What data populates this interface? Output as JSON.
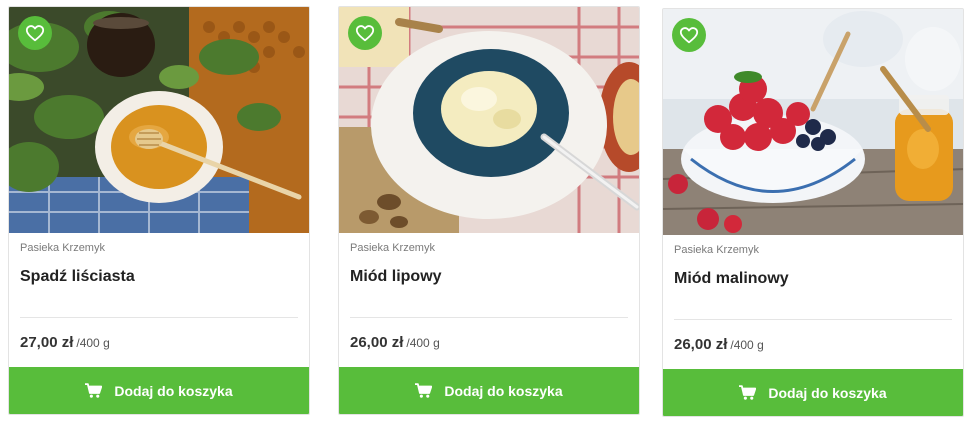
{
  "products": [
    {
      "vendor": "Pasieka Krzemyk",
      "name": "Spadź liściasta",
      "price": "27,00 zł",
      "unit": "/400 g",
      "button_label": "Dodaj do koszyka",
      "image_description": "honey dipper in honey bowl with oak leaves and honeycomb"
    },
    {
      "vendor": "Pasieka Krzemyk",
      "name": "Miód lipowy",
      "price": "26,00 zł",
      "unit": "/400 g",
      "button_label": "Dodaj do koszyka",
      "image_description": "creamed linden honey in blue bowl with spoon"
    },
    {
      "vendor": "Pasieka Krzemyk",
      "name": "Miód malinowy",
      "price": "26,00 zł",
      "unit": "/400 g",
      "button_label": "Dodaj do koszyka",
      "image_description": "bowl of strawberries and blueberries with honey jar"
    }
  ],
  "icons": {
    "favorite": "heart-icon",
    "cart": "cart-icon"
  },
  "colors": {
    "accent_green": "#58bd3b",
    "title": "#222222",
    "vendor": "#7a7a7a"
  }
}
